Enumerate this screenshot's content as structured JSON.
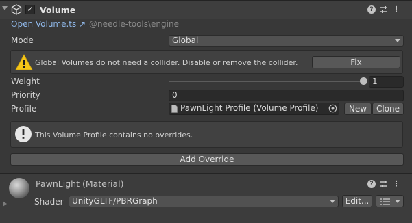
{
  "component": {
    "title": "Volume",
    "enabled_check": "✓",
    "script_link": "Open Volume.ts ↗",
    "script_path": "@needle-tools\\engine",
    "header_icons": [
      "help-icon",
      "presets-icon",
      "more-icon"
    ]
  },
  "mode": {
    "label": "Mode",
    "value": "Global"
  },
  "warning": {
    "text": "Global Volumes do not need a collider. Disable or remove the collider.",
    "fix_label": "Fix",
    "icon": "warning-icon"
  },
  "weight": {
    "label": "Weight",
    "value": "1",
    "slider_fraction": 1.0
  },
  "priority": {
    "label": "Priority",
    "value": "0"
  },
  "profile": {
    "label": "Profile",
    "value": "PawnLight Profile (Volume Profile)",
    "new_label": "New",
    "clone_label": "Clone"
  },
  "info": {
    "text": "This Volume Profile contains no overrides.",
    "icon": "info-icon"
  },
  "add_override_label": "Add Override",
  "material": {
    "title": "PawnLight (Material)",
    "shader_label": "Shader",
    "shader_value": "UnityGLTF/PBRGraph",
    "edit_label": "Edit...",
    "list_icon": "list-icon"
  },
  "colors": {
    "background": "#383838",
    "link": "#8fb7e8",
    "warning": "#f5c518"
  }
}
